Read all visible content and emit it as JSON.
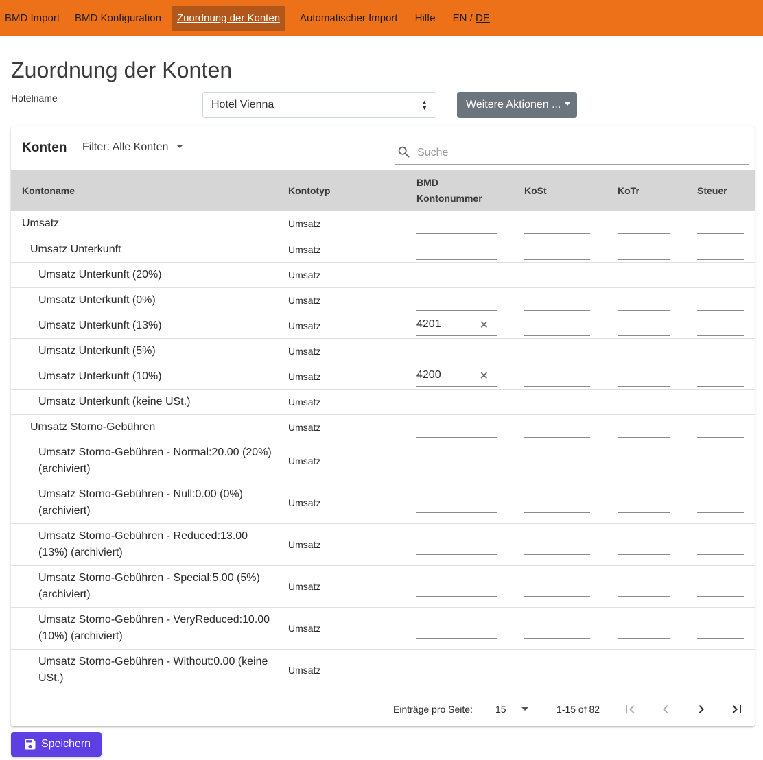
{
  "nav": {
    "items": [
      {
        "label": "BMD Import"
      },
      {
        "label": "BMD Konfiguration"
      },
      {
        "label": "Zuordnung der Konten"
      },
      {
        "label": "Automatischer Import"
      },
      {
        "label": "Hilfe"
      }
    ],
    "active_index": 2,
    "lang_en": "EN",
    "lang_sep": " / ",
    "lang_de": "DE",
    "accent_color": "#ec7118"
  },
  "page": {
    "title": "Zuordnung der Konten",
    "hotel_label": "Hotelname",
    "hotel_value": "Hotel Vienna",
    "actions_label": "Weitere Aktionen ..."
  },
  "card": {
    "title": "Konten",
    "filter": "Filter: Alle Konten",
    "search_placeholder": "Suche"
  },
  "table": {
    "headers": {
      "name": "Kontoname",
      "type": "Kontotyp",
      "bmd_line1": "BMD",
      "bmd_line2": "Kontonummer",
      "kost": "KoSt",
      "kotr": "KoTr",
      "steuer": "Steuer"
    },
    "rows": [
      {
        "name": "Umsatz",
        "type": "Umsatz",
        "bmd": ""
      },
      {
        "name": "Umsatz Unterkunft",
        "type": "Umsatz",
        "bmd": ""
      },
      {
        "name": "Umsatz Unterkunft (20%)",
        "type": "Umsatz",
        "bmd": ""
      },
      {
        "name": "Umsatz Unterkunft (0%)",
        "type": "Umsatz",
        "bmd": ""
      },
      {
        "name": "Umsatz Unterkunft (13%)",
        "type": "Umsatz",
        "bmd": "4201"
      },
      {
        "name": "Umsatz Unterkunft (5%)",
        "type": "Umsatz",
        "bmd": ""
      },
      {
        "name": "Umsatz Unterkunft (10%)",
        "type": "Umsatz",
        "bmd": "4200"
      },
      {
        "name": "Umsatz Unterkunft (keine USt.)",
        "type": "Umsatz",
        "bmd": ""
      },
      {
        "name": "Umsatz Storno-Gebühren",
        "type": "Umsatz",
        "bmd": ""
      },
      {
        "name": "Umsatz Storno-Gebühren - Normal:20.00 (20%) (archiviert)",
        "type": "Umsatz",
        "bmd": ""
      },
      {
        "name": "Umsatz Storno-Gebühren - Null:0.00 (0%) (archiviert)",
        "type": "Umsatz",
        "bmd": ""
      },
      {
        "name": "Umsatz Storno-Gebühren - Reduced:13.00 (13%) (archiviert)",
        "type": "Umsatz",
        "bmd": ""
      },
      {
        "name": "Umsatz Storno-Gebühren - Special:5.00 (5%) (archiviert)",
        "type": "Umsatz",
        "bmd": ""
      },
      {
        "name": "Umsatz Storno-Gebühren - VeryReduced:10.00 (10%) (archiviert)",
        "type": "Umsatz",
        "bmd": ""
      },
      {
        "name": "Umsatz Storno-Gebühren - Without:0.00 (keine USt.)",
        "type": "Umsatz",
        "bmd": ""
      }
    ]
  },
  "pagination": {
    "per_page_label": "Einträge pro Seite:",
    "per_page_value": "15",
    "range": "1-15 of 82"
  },
  "save": {
    "label": "Speichern",
    "color": "#5e3fe3"
  }
}
